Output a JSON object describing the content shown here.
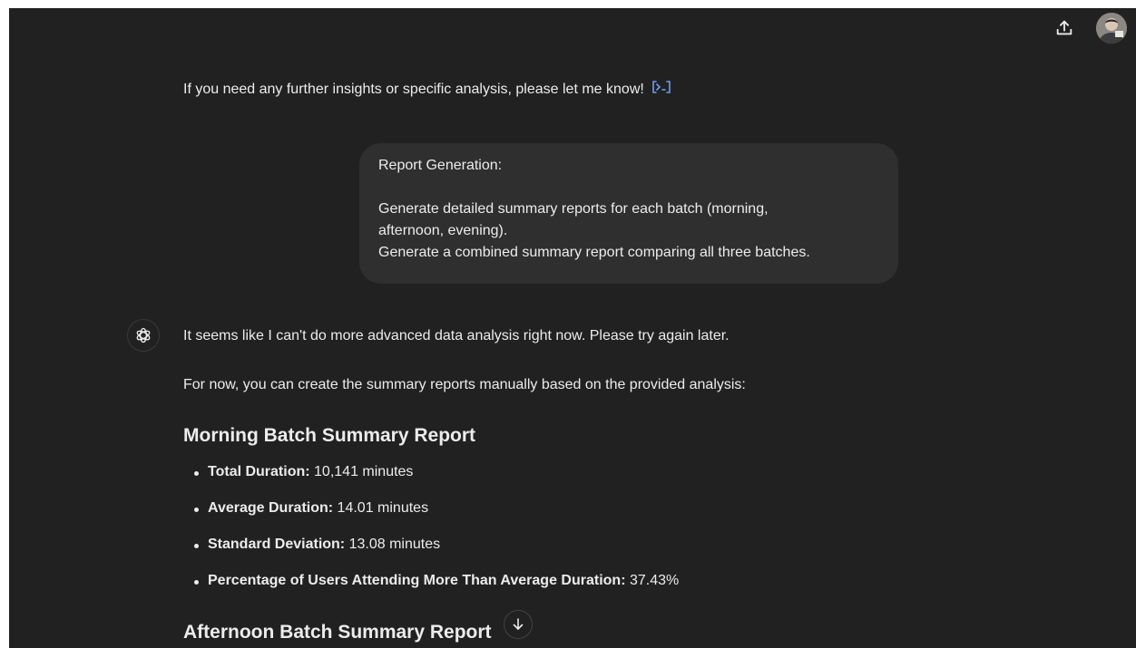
{
  "topbar": {
    "share_icon": "share-upload-icon",
    "avatar_icon": "user-avatar"
  },
  "messages": {
    "previous_tail": {
      "text": "If you need any further insights or specific analysis, please let me know!",
      "citation": "[>-]"
    },
    "user": {
      "line1": "Report Generation:",
      "line2": "Generate detailed summary reports for each batch (morning,",
      "line3": "afternoon, evening).",
      "line4": "Generate a combined summary report comparing all three batches."
    },
    "assistant": {
      "intro": "It seems like I can't do more advanced data analysis right now. Please try again later.",
      "followup": "For now, you can create the summary reports manually based on the provided analysis:",
      "morning_title": "Morning Batch Summary Report",
      "morning_items": [
        {
          "label": "Total Duration:",
          "value": " 10,141 minutes"
        },
        {
          "label": "Average Duration:",
          "value": " 14.01 minutes"
        },
        {
          "label": "Standard Deviation:",
          "value": " 13.08 minutes"
        },
        {
          "label": "Percentage of Users Attending More Than Average Duration:",
          "value": " 37.43%"
        }
      ],
      "afternoon_title": "Afternoon Batch Summary Report"
    }
  },
  "colors": {
    "background": "#212121",
    "bubble": "#2f2f2f",
    "text": "#ececec",
    "citation": "#6b9df5"
  }
}
